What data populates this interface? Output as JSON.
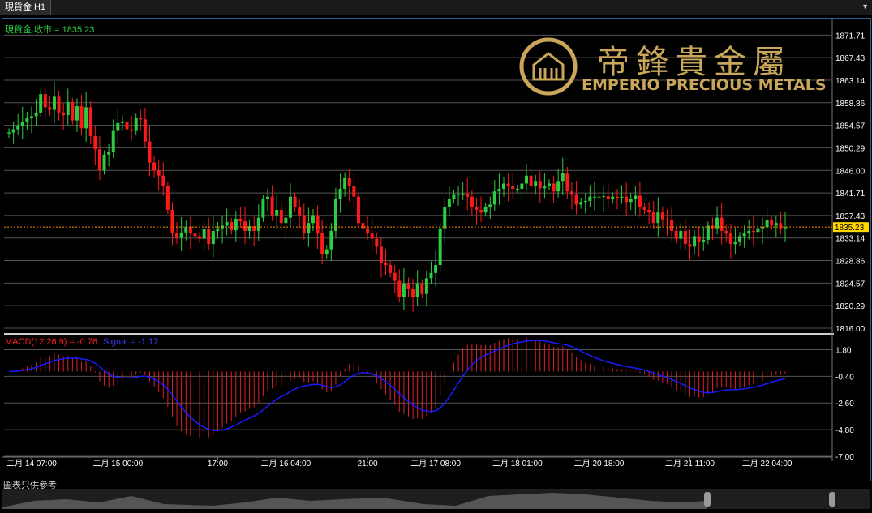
{
  "window": {
    "tab_label": "現貨金 H1"
  },
  "price_panel": {
    "info_label": "現貨金.收市 = 1835.23",
    "current_price_label": "1835.23"
  },
  "macd_panel": {
    "info_label_macd": "MACD(12,26,9) = -0.76",
    "info_label_signal": "Signal = -1.17"
  },
  "logo": {
    "chinese": "帝鋒貴金屬",
    "english": "EMPERIO PRECIOUS METALS"
  },
  "footer": {
    "note": "圖表只供參考"
  },
  "colors": {
    "up": "#2ecc40",
    "down": "#ff1a1a",
    "signal": "#1a1aff",
    "macd_hist": "#e02020",
    "price_line": "#ff8c00",
    "grid": "#555555",
    "logo_gold": "#c9a65a"
  },
  "chart_data": [
    {
      "type": "candlestick",
      "title": "現貨金 H1",
      "ylim": [
        1816.0,
        1873.0
      ],
      "y_ticks": [
        "1871.71",
        "1867.43",
        "1863.14",
        "1858.86",
        "1854.57",
        "1850.29",
        "1846.00",
        "1841.71",
        "1837.43",
        "1833.14",
        "1828.86",
        "1824.57",
        "1820.29",
        "1816.00"
      ],
      "x_tick_labels": [
        "二月 14 07:00",
        "二月 15 00:00",
        "17:00",
        "二月 16 04:00",
        "21:00",
        "二月 17 08:00",
        "二月 18 01:00",
        "二月 20 18:00",
        "二月 21 11:00",
        "二月 22 04:00"
      ],
      "last_price": 1835.23,
      "close": [
        1853.2,
        1853.8,
        1854.5,
        1855.2,
        1856.0,
        1856.3,
        1857.0,
        1860.5,
        1858.0,
        1857.5,
        1860.0,
        1857.0,
        1856.5,
        1859.0,
        1855.5,
        1858.2,
        1854.0,
        1858.0,
        1852.5,
        1850.0,
        1846.0,
        1849.0,
        1849.5,
        1853.5,
        1855.0,
        1855.3,
        1853.8,
        1853.5,
        1856.0,
        1855.7,
        1851.5,
        1847.5,
        1846.0,
        1845.0,
        1843.0,
        1838.5,
        1834.0,
        1833.2,
        1834.2,
        1835.3,
        1834.0,
        1833.5,
        1833.0,
        1834.8,
        1832.0,
        1834.5,
        1835.0,
        1835.5,
        1836.2,
        1834.6,
        1836.8,
        1836.3,
        1834.5,
        1835.4,
        1834.5,
        1837.0,
        1840.5,
        1841.0,
        1837.5,
        1838.5,
        1836.0,
        1837.0,
        1841.0,
        1839.0,
        1837.5,
        1834.0,
        1836.0,
        1837.5,
        1834.0,
        1830.0,
        1831.0,
        1834.5,
        1840.5,
        1842.5,
        1844.5,
        1843.0,
        1841.0,
        1836.0,
        1835.0,
        1834.0,
        1833.0,
        1831.5,
        1828.5,
        1828.0,
        1826.5,
        1825.0,
        1822.0,
        1824.5,
        1823.5,
        1822.0,
        1824.5,
        1822.5,
        1825.5,
        1826.5,
        1828.0,
        1835.0,
        1839.0,
        1840.5,
        1841.5,
        1841.5,
        1841.6,
        1841.0,
        1839.0,
        1838.5,
        1838.0,
        1839.0,
        1839.5,
        1842.0,
        1842.5,
        1843.5,
        1843.0,
        1842.5,
        1842.5,
        1843.5,
        1845.0,
        1843.0,
        1844.0,
        1842.6,
        1843.0,
        1843.5,
        1842.0,
        1844.0,
        1845.5,
        1842.0,
        1841.5,
        1839.5,
        1840.0,
        1840.2,
        1841.0,
        1841.0,
        1841.0,
        1841.1,
        1840.5,
        1841.0,
        1840.8,
        1841.0,
        1840.0,
        1840.5,
        1841.2,
        1839.0,
        1838.5,
        1838.0,
        1836.0,
        1838.0,
        1836.7,
        1836.5,
        1834.5,
        1833.0,
        1834.5,
        1832.0,
        1831.5,
        1833.5,
        1832.5,
        1832.8,
        1835.5,
        1835.0,
        1837.0,
        1834.5,
        1834.0,
        1832.0,
        1832.5,
        1833.5,
        1834.0,
        1834.5,
        1834.3,
        1835.0,
        1835.2,
        1836.5,
        1835.5,
        1836.0,
        1835.0,
        1835.23
      ],
      "open": [
        1853.0,
        1853.2,
        1853.8,
        1854.5,
        1855.2,
        1856.0,
        1856.3,
        1857.0,
        1860.5,
        1858.0,
        1857.5,
        1860.0,
        1857.0,
        1856.5,
        1859.0,
        1855.5,
        1858.2,
        1854.0,
        1858.0,
        1852.5,
        1850.0,
        1846.0,
        1849.0,
        1849.5,
        1853.5,
        1855.0,
        1855.3,
        1853.8,
        1853.5,
        1856.0,
        1855.7,
        1851.5,
        1847.5,
        1846.0,
        1845.0,
        1843.0,
        1838.5,
        1834.0,
        1833.2,
        1834.2,
        1835.3,
        1834.0,
        1833.5,
        1833.0,
        1834.8,
        1832.0,
        1834.5,
        1835.0,
        1835.5,
        1836.2,
        1834.6,
        1836.8,
        1836.3,
        1834.5,
        1835.4,
        1834.5,
        1837.0,
        1840.5,
        1841.0,
        1837.5,
        1838.5,
        1836.0,
        1837.0,
        1841.0,
        1839.0,
        1837.5,
        1834.0,
        1836.0,
        1837.5,
        1834.0,
        1830.0,
        1831.0,
        1834.5,
        1840.5,
        1842.5,
        1844.5,
        1843.0,
        1841.0,
        1836.0,
        1835.0,
        1834.0,
        1833.0,
        1831.5,
        1828.5,
        1828.0,
        1826.5,
        1825.0,
        1822.0,
        1824.5,
        1823.5,
        1822.0,
        1824.5,
        1822.5,
        1825.5,
        1826.5,
        1828.0,
        1835.0,
        1839.0,
        1840.5,
        1841.5,
        1841.5,
        1841.6,
        1841.0,
        1839.0,
        1838.5,
        1838.0,
        1839.0,
        1839.5,
        1842.0,
        1842.5,
        1843.5,
        1843.0,
        1842.5,
        1842.5,
        1843.5,
        1845.0,
        1843.0,
        1844.0,
        1842.6,
        1843.0,
        1843.5,
        1842.0,
        1844.0,
        1845.5,
        1842.0,
        1841.5,
        1839.5,
        1840.0,
        1840.2,
        1841.0,
        1841.0,
        1841.0,
        1841.1,
        1840.5,
        1841.0,
        1840.8,
        1841.0,
        1840.0,
        1840.5,
        1841.2,
        1839.0,
        1838.5,
        1838.0,
        1836.0,
        1838.0,
        1836.7,
        1836.5,
        1834.5,
        1833.0,
        1834.5,
        1832.0,
        1831.5,
        1833.5,
        1832.5,
        1832.8,
        1835.5,
        1835.0,
        1837.0,
        1834.5,
        1834.0,
        1832.0,
        1832.5,
        1833.5,
        1834.0,
        1834.5,
        1834.3,
        1835.0,
        1835.2,
        1836.5,
        1835.5,
        1836.0,
        1835.0
      ],
      "macd_ylim": [
        -7.0,
        2.5
      ],
      "macd_y_ticks": [
        "1.80",
        "-0.40",
        "-2.60",
        "-4.80",
        "-7.00"
      ],
      "macd_last": -0.76,
      "signal_last": -1.17
    }
  ]
}
